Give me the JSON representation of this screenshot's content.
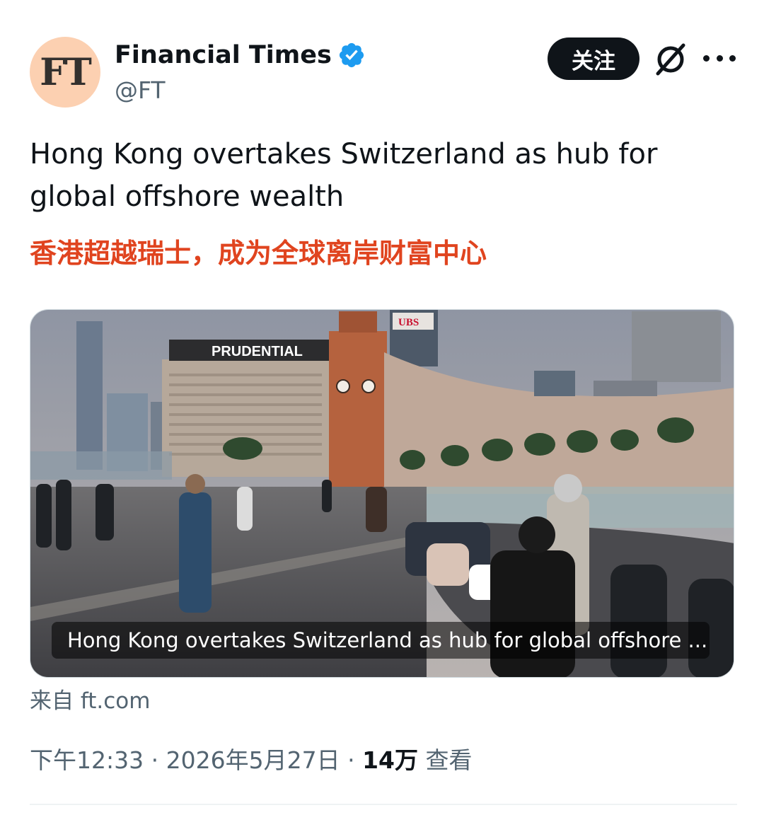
{
  "author": {
    "avatar_text": "FT",
    "name": "Financial Times",
    "handle": "@FT"
  },
  "actions": {
    "follow_label": "关注"
  },
  "tweet": {
    "text": "Hong Kong overtakes Switzerland as hub for global offshore wealth",
    "translation": "香港超越瑞士，成为全球离岸财富中心"
  },
  "card": {
    "caption": "Hong Kong overtakes Switzerland as hub for global offshore ...",
    "signs": [
      "PRUDENTIAL",
      "UBS"
    ]
  },
  "source": {
    "text": "来自 ft.com"
  },
  "meta": {
    "time": "下午12:33",
    "sep1": " · ",
    "date": "2026年5月27日",
    "sep2": " · ",
    "views_count": "14万",
    "views_label": " 查看"
  },
  "colors": {
    "verified": "#1d9bf0",
    "translation": "#e0441f",
    "avatar_bg": "#fcd0b1"
  }
}
